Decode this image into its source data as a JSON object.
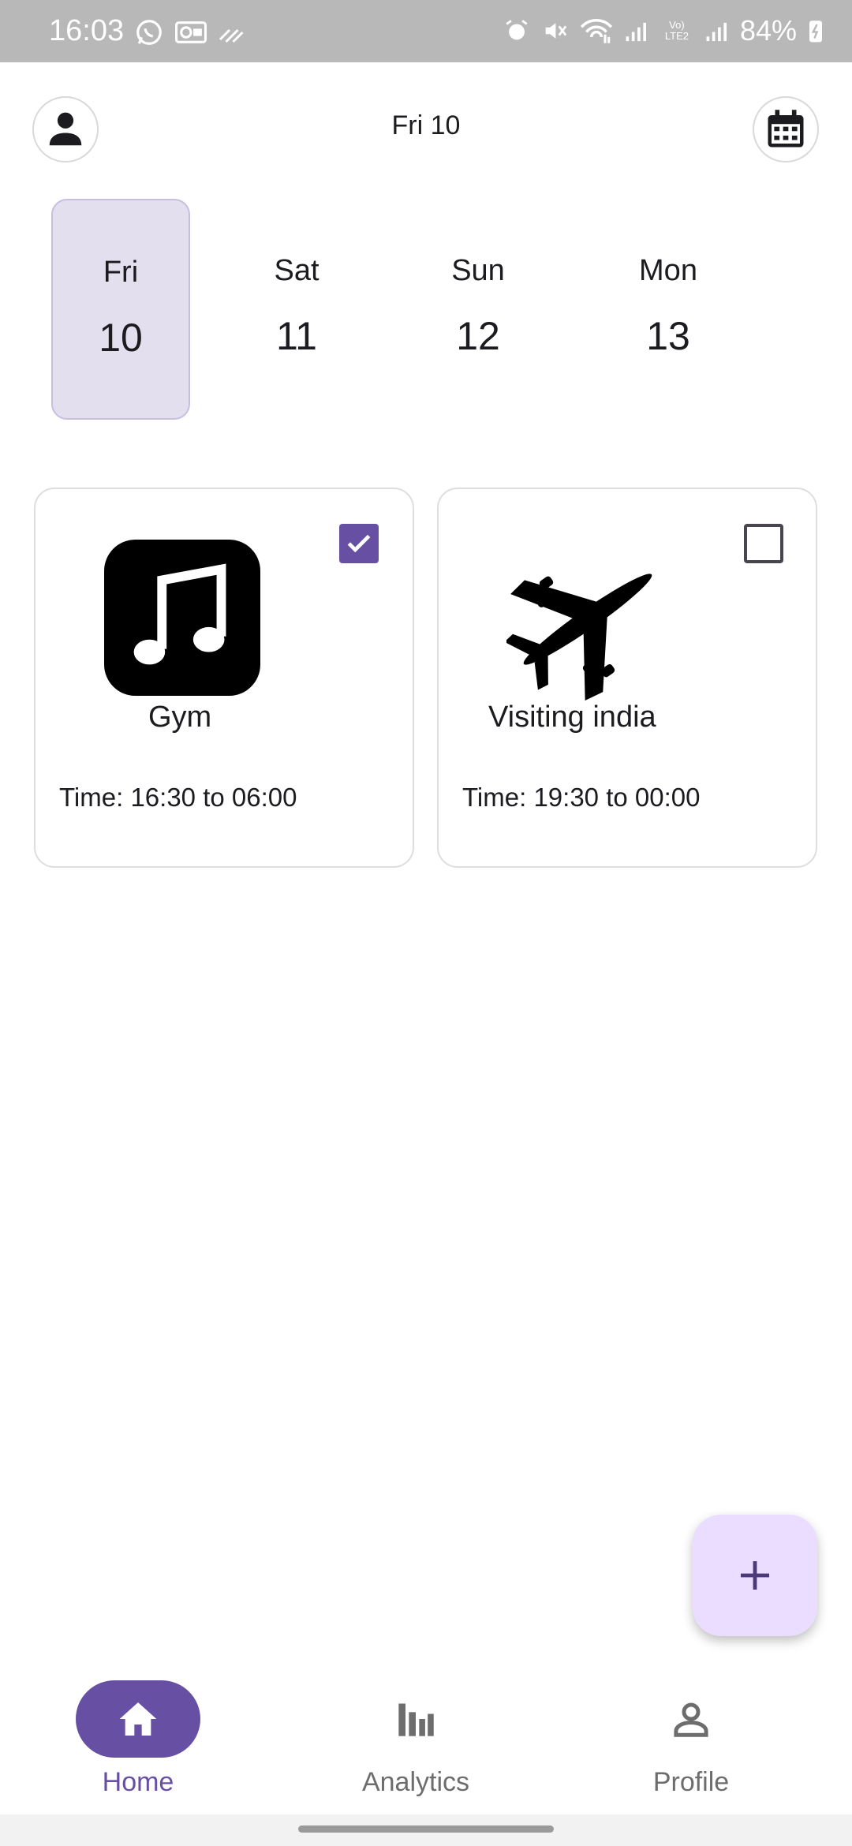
{
  "status_bar": {
    "time": "16:03",
    "battery": "84%",
    "left_icons": [
      "whatsapp-icon",
      "vpn-icon",
      "signal-waves-icon"
    ],
    "right_icons": [
      "alarm-icon",
      "mute-icon",
      "wifi-icon",
      "cell-signal-icon",
      "volte-icon",
      "cell-signal-icon",
      "battery-charging-icon"
    ],
    "volte_text": "Vo) LTE2"
  },
  "header": {
    "title": "Fri 10",
    "left_icon": "person-icon",
    "right_icon": "calendar-icon"
  },
  "days": [
    {
      "name": "Fri",
      "number": "10",
      "selected": true
    },
    {
      "name": "Sat",
      "number": "11",
      "selected": false
    },
    {
      "name": "Sun",
      "number": "12",
      "selected": false
    },
    {
      "name": "Mon",
      "number": "13",
      "selected": false
    }
  ],
  "cards": [
    {
      "title": "Gym",
      "time": "Time: 16:30 to 06:00",
      "icon": "music-note-icon",
      "checked": true
    },
    {
      "title": "Visiting india",
      "time": "Time: 19:30 to 00:00",
      "icon": "airplane-icon",
      "checked": false
    }
  ],
  "fab": {
    "icon": "plus-icon"
  },
  "bottom_nav": [
    {
      "label": "Home",
      "icon": "home-icon",
      "active": true
    },
    {
      "label": "Analytics",
      "icon": "bar-chart-icon",
      "active": false
    },
    {
      "label": "Profile",
      "icon": "profile-icon",
      "active": false
    }
  ],
  "colors": {
    "primary": "#6750a4",
    "selected_day_bg": "#e3dfee",
    "fab_bg": "#eaddff",
    "status_bar_bg": "#b8b8b8"
  }
}
